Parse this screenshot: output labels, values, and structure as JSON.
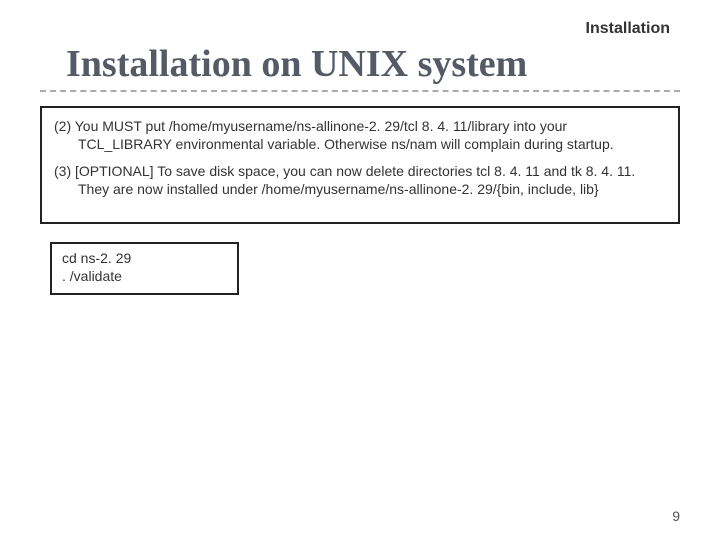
{
  "header_label": "Installation",
  "title": "Installation on UNIX system",
  "instructions": {
    "step2_lead": "(2) You MUST put /home/myusername/ns-allinone-2. 29/tcl 8. 4. 11/library into your",
    "step2_cont": "TCL_LIBRARY environmental variable. Otherwise ns/nam will complain during startup.",
    "step3_lead": "(3) [OPTIONAL] To save disk space, you can now delete directories tcl 8. 4. 11 and tk 8. 4. 11.",
    "step3_cont": "They are now installed under /home/myusername/ns-allinone-2. 29/{bin, include, lib}"
  },
  "code": {
    "line1": "cd ns-2. 29",
    "line2": ". /validate"
  },
  "page_number": "9"
}
